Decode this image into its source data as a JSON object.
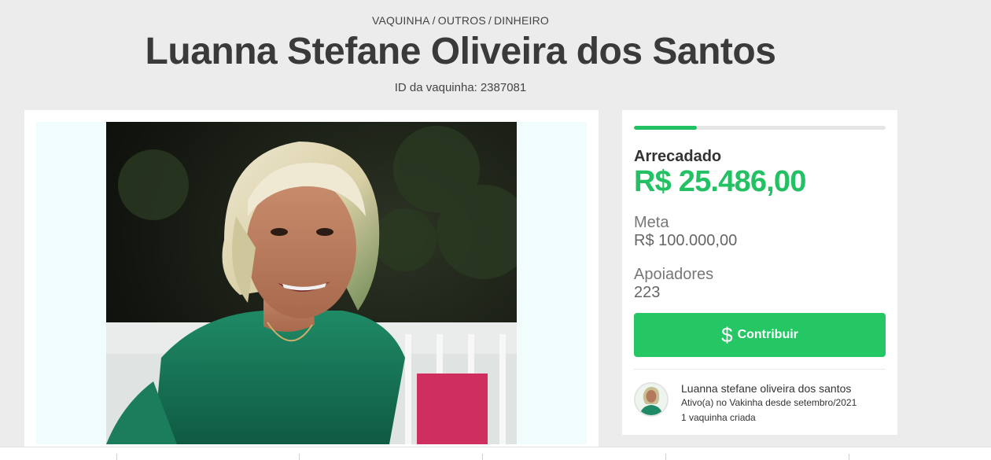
{
  "breadcrumb": {
    "items": [
      "VAQUINHA",
      "OUTROS",
      "DINHEIRO"
    ],
    "separator": "/"
  },
  "campaign": {
    "title": "Luanna Stefane Oliveira dos Santos",
    "id_label": "ID da vaquinha:",
    "id_value": "2387081"
  },
  "stats": {
    "progress_fraction": 0.25,
    "raised_label": "Arrecadado",
    "raised_value": "R$ 25.486,00",
    "goal_label": "Meta",
    "goal_value": "R$ 100.000,00",
    "backers_label": "Apoiadores",
    "backers_value": "223"
  },
  "contribute": {
    "icon": "dollar-icon",
    "label": "Contribuir"
  },
  "creator": {
    "name": "Luanna stefane oliveira dos santos",
    "since": "Ativo(a) no Vakinha desde setembro/2021",
    "count": "1 vaquinha criada"
  },
  "colors": {
    "accent": "#24c164",
    "button": "#24c764",
    "background": "#ececec",
    "card": "#ffffff"
  }
}
